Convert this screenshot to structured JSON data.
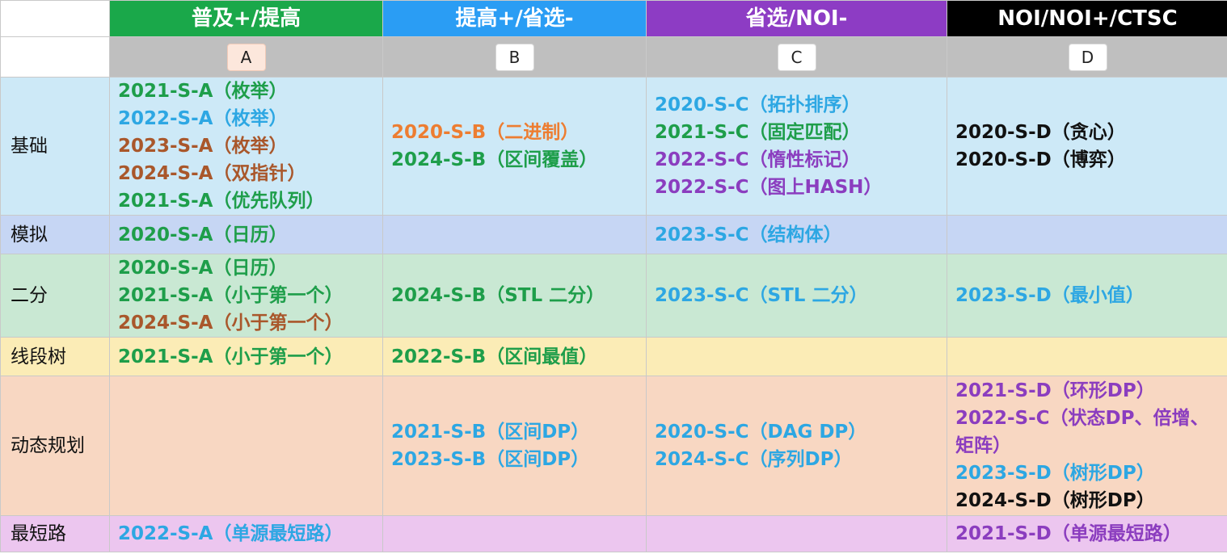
{
  "colors": {
    "level_headers": [
      "#1aa84a",
      "#2a9df4",
      "#8d3cc4",
      "#000000"
    ],
    "row_backgrounds": {
      "basics": "#cde9f7",
      "simulation": "#c6d6f4",
      "binary_search": "#c9e8d3",
      "segment_tree": "#fbecb6",
      "dynamic_programming": "#f8d7c2",
      "shortest_path": "#ecc6ef"
    }
  },
  "headers": {
    "levels": [
      "普及+/提高",
      "提高+/省选-",
      "省选/NOI-",
      "NOI/NOI+/CTSC"
    ],
    "letters": [
      "A",
      "B",
      "C",
      "D"
    ],
    "selected_letter": "A"
  },
  "rows": [
    {
      "label": "基础",
      "cells": [
        [
          {
            "text": "2021-S-A（枚举）",
            "color": "green"
          },
          {
            "text": "2022-S-A（枚举）",
            "color": "blue"
          },
          {
            "text": "2023-S-A（枚举）",
            "color": "brown"
          },
          {
            "text": "2024-S-A（双指针）",
            "color": "brown"
          },
          {
            "text": "2021-S-A（优先队列）",
            "color": "green"
          }
        ],
        [
          {
            "text": "2020-S-B（二进制）",
            "color": "orange"
          },
          {
            "text": "2024-S-B（区间覆盖）",
            "color": "green"
          }
        ],
        [
          {
            "text": "2020-S-C（拓扑排序）",
            "color": "blue"
          },
          {
            "text": "2021-S-C（固定匹配）",
            "color": "green"
          },
          {
            "text": "2022-S-C（惰性标记）",
            "color": "purple"
          },
          {
            "text": "2022-S-C（图上HASH）",
            "color": "purple"
          }
        ],
        [
          {
            "text": "2020-S-D（贪心）",
            "color": "black"
          },
          {
            "text": "2020-S-D（博弈）",
            "color": "black"
          }
        ]
      ]
    },
    {
      "label": "模拟",
      "cells": [
        [
          {
            "text": "2020-S-A（日历）",
            "color": "green"
          }
        ],
        [],
        [
          {
            "text": "2023-S-C（结构体）",
            "color": "blue"
          }
        ],
        []
      ]
    },
    {
      "label": "二分",
      "cells": [
        [
          {
            "text": "2020-S-A（日历）",
            "color": "green"
          },
          {
            "text": "2021-S-A（小于第一个）",
            "color": "green"
          },
          {
            "text": "2024-S-A（小于第一个）",
            "color": "brown"
          }
        ],
        [
          {
            "text": "2024-S-B（STL 二分）",
            "color": "green"
          }
        ],
        [
          {
            "text": "2023-S-C（STL 二分）",
            "color": "blue"
          }
        ],
        [
          {
            "text": "2023-S-D（最小值）",
            "color": "blue"
          }
        ]
      ]
    },
    {
      "label": "线段树",
      "cells": [
        [
          {
            "text": "2021-S-A（小于第一个）",
            "color": "green"
          }
        ],
        [
          {
            "text": "2022-S-B（区间最值）",
            "color": "green"
          }
        ],
        [],
        []
      ]
    },
    {
      "label": "动态规划",
      "cells": [
        [],
        [
          {
            "text": "2021-S-B（区间DP）",
            "color": "blue"
          },
          {
            "text": "2023-S-B（区间DP）",
            "color": "blue"
          }
        ],
        [
          {
            "text": "2020-S-C（DAG DP）",
            "color": "blue"
          },
          {
            "text": "2024-S-C（序列DP）",
            "color": "blue"
          }
        ],
        [
          {
            "text": "2021-S-D（环形DP）",
            "color": "purple"
          },
          {
            "text": "2022-S-C（状态DP、倍增、矩阵）",
            "color": "purple"
          },
          {
            "text": "2023-S-D（树形DP）",
            "color": "blue"
          },
          {
            "text": "2024-S-D（树形DP）",
            "color": "black"
          }
        ]
      ]
    },
    {
      "label": "最短路",
      "cells": [
        [
          {
            "text": "2022-S-A（单源最短路）",
            "color": "blue"
          }
        ],
        [],
        [],
        [
          {
            "text": "2021-S-D（单源最短路）",
            "color": "purple"
          }
        ]
      ]
    }
  ]
}
